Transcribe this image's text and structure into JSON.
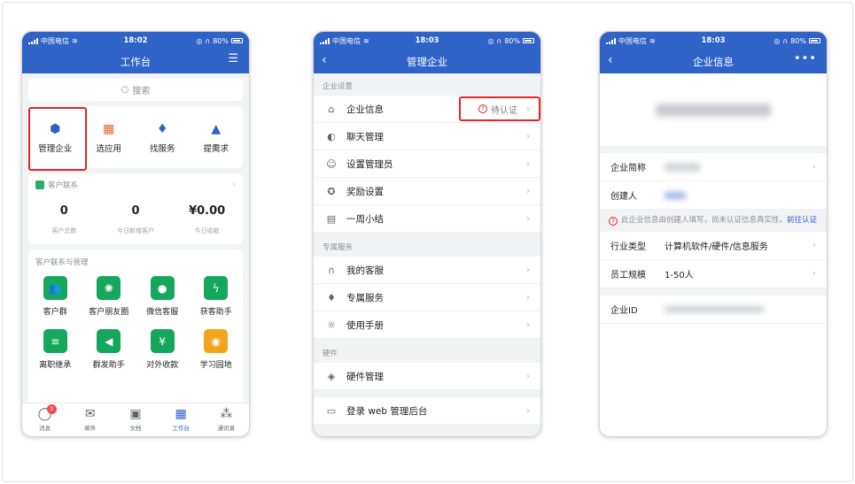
{
  "status": {
    "carrier": "中国电信",
    "battery": "80%",
    "time1": "18:02",
    "time2": "18:03",
    "time3": "18:03"
  },
  "screen1": {
    "title": "工作台",
    "search_placeholder": "搜索",
    "apps": [
      "管理企业",
      "选应用",
      "找服务",
      "提需求"
    ],
    "customer_contact": {
      "title": "客户联系",
      "stats": [
        {
          "value": "0",
          "label": "客户总数"
        },
        {
          "value": "0",
          "label": "今日新增客户"
        },
        {
          "value": "¥0.00",
          "label": "今日收款"
        }
      ]
    },
    "management": {
      "title": "客户联系与管理",
      "items": [
        "客户群",
        "客户朋友圈",
        "微信客服",
        "获客助手",
        "离职继承",
        "群发助手",
        "对外收款",
        "学习园地"
      ]
    },
    "tabs": [
      {
        "label": "消息",
        "badge": "3"
      },
      {
        "label": "邮件"
      },
      {
        "label": "文档"
      },
      {
        "label": "工作台"
      },
      {
        "label": "通讯录"
      }
    ]
  },
  "screen2": {
    "title": "管理企业",
    "sections": [
      {
        "label": "企业设置",
        "items": [
          "企业信息",
          "聊天管理",
          "设置管理员",
          "奖励设置",
          "一周小结"
        ]
      },
      {
        "label": "专属服务",
        "items": [
          "我的客服",
          "专属服务",
          "使用手册"
        ]
      },
      {
        "label": "硬件",
        "items": [
          "硬件管理"
        ]
      }
    ],
    "pending_label": "待认证",
    "web_login": "登录 web 管理后台"
  },
  "screen3": {
    "title": "企业信息",
    "more": "•••",
    "short_name_label": "企业简称",
    "creator_label": "创建人",
    "notice_text": "此企业信息由创建人填写，尚未认证信息真实性。",
    "notice_link": "前往认证",
    "industry_label": "行业类型",
    "industry_value": "计算机软件/硬件/信息服务",
    "size_label": "员工规模",
    "size_value": "1-50人",
    "id_label": "企业ID"
  },
  "colors": {
    "primary": "#2f63c8",
    "highlight": "#e0262a",
    "green": "#15a85c"
  }
}
